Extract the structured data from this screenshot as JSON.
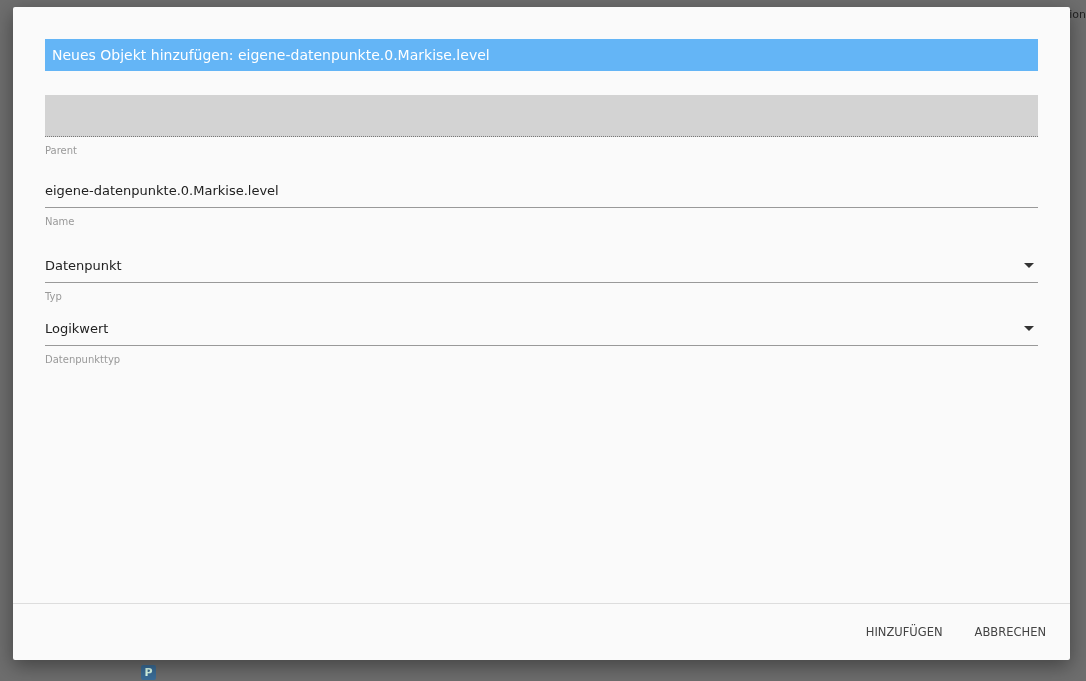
{
  "background": {
    "header_fragment": "ion",
    "badge": "P"
  },
  "dialog": {
    "title": "Neues Objekt hinzufügen: eigene-datenpunkte.0.Markise.level",
    "fields": [
      {
        "kind": "text",
        "label": "Parent",
        "disabled": true
      },
      {
        "kind": "text",
        "label": "Name",
        "value": "eigene-datenpunkte.0.Markise.level",
        "disabled": false
      },
      {
        "kind": "select",
        "label": "Typ",
        "value": "Datenpunkt",
        "disabled": false
      },
      {
        "kind": "select",
        "label": "Datenpunkttyp",
        "value": "Logikwert",
        "disabled": false
      }
    ],
    "buttons": [
      "HINZUFÜGEN",
      "ABBRECHEN"
    ]
  }
}
